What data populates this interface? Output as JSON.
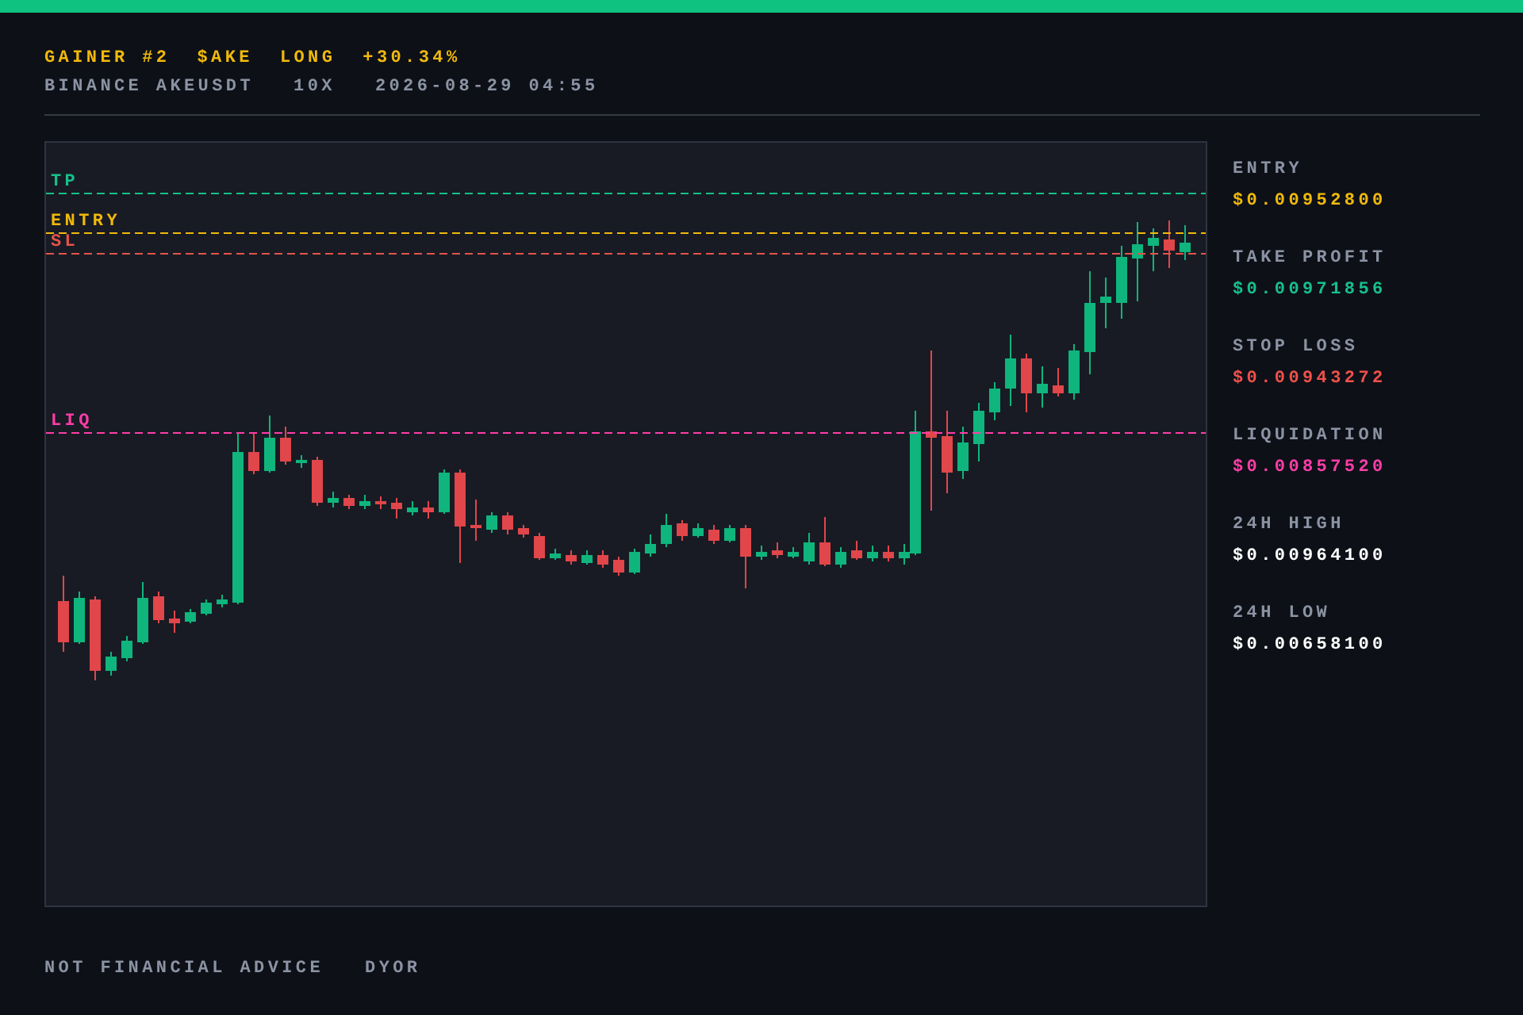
{
  "header": {
    "title": [
      "GAINER #2",
      "$AKE",
      "LONG",
      "+30.34%"
    ],
    "subtitle": [
      "BINANCE AKEUSDT",
      "10X",
      "2026-08-29 04:55"
    ]
  },
  "chart": {
    "levels": [
      {
        "kind": "tp",
        "label": "TP",
        "color": "#16c08a"
      },
      {
        "kind": "entry",
        "label": "ENTRY",
        "color": "#f0b90b"
      },
      {
        "kind": "sl",
        "label": "SL",
        "color": "#e5534b"
      },
      {
        "kind": "liq",
        "label": "LIQ",
        "color": "#ff3da8"
      }
    ]
  },
  "stats": [
    {
      "label": "ENTRY",
      "value": "$0.00952800",
      "color": "#f0b90b"
    },
    {
      "label": "TAKE PROFIT",
      "value": "$0.00971856",
      "color": "#16c08a"
    },
    {
      "label": "STOP LOSS",
      "value": "$0.00943272",
      "color": "#f0504a"
    },
    {
      "label": "LIQUIDATION",
      "value": "$0.00857520",
      "color": "#ff3da8"
    },
    {
      "label": "24H HIGH",
      "value": "$0.00964100",
      "color": "#ffffff"
    },
    {
      "label": "24H LOW",
      "value": "$0.00658100",
      "color": "#ffffff"
    }
  ],
  "footer": [
    "NOT FINANCIAL ADVICE",
    "DYOR"
  ]
}
